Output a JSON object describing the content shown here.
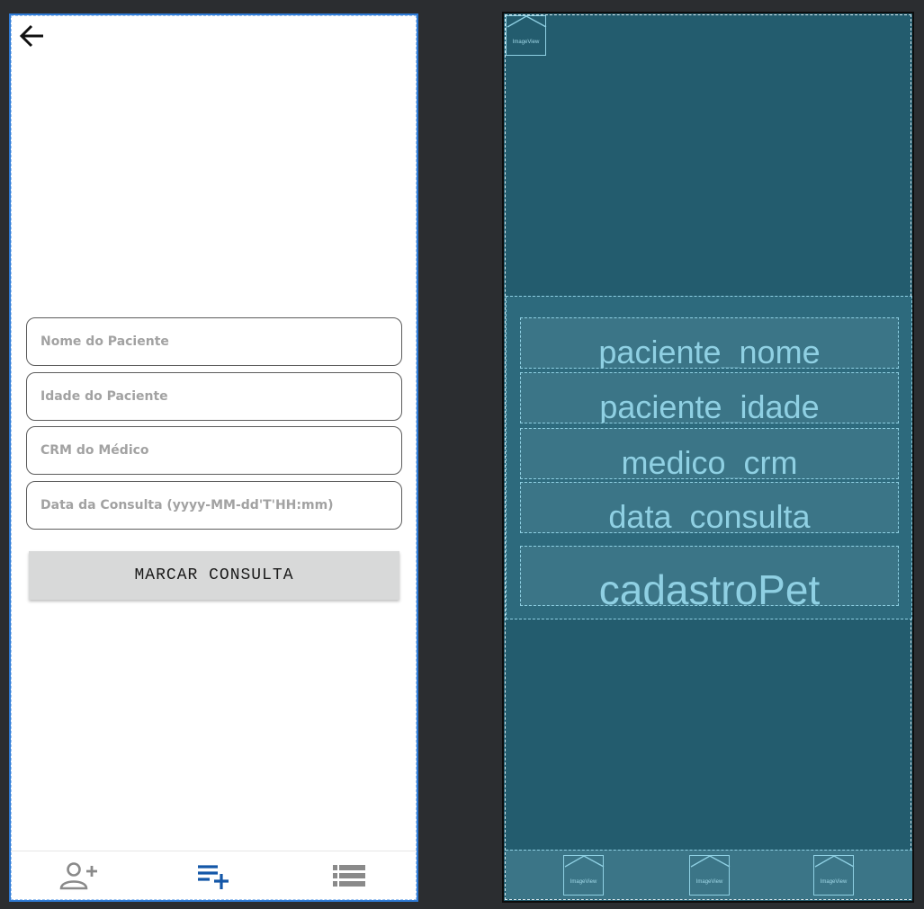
{
  "design": {
    "back_icon": "arrow-left-icon",
    "form": {
      "fields": [
        {
          "placeholder": "Nome do Paciente"
        },
        {
          "placeholder": "Idade do Paciente"
        },
        {
          "placeholder": "CRM do Médico"
        },
        {
          "placeholder": "Data da Consulta (yyyy-MM-dd'T'HH:mm)"
        }
      ],
      "submit_label": "MARCAR CONSULTA"
    },
    "bottom_nav": [
      {
        "icon": "person-add-icon",
        "active": false
      },
      {
        "icon": "playlist-add-icon",
        "active": true
      },
      {
        "icon": "list-icon",
        "active": false
      }
    ],
    "colors": {
      "active": "#1457a8",
      "inactive": "#8a8a8a",
      "frame": "#2f7bd6"
    }
  },
  "blueprint": {
    "image_view_label": "ImageView",
    "field_ids": [
      "paciente_nome",
      "paciente_idade",
      "medico_crm",
      "data_consulta"
    ],
    "button_id": "cadastroPet",
    "colors": {
      "background": "#235c6e",
      "outline": "#8fd0e3"
    }
  }
}
